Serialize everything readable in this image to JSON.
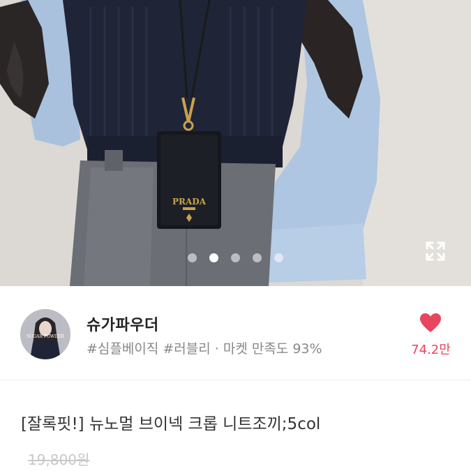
{
  "carousel": {
    "product_logo_text": "PRADA",
    "total_slides": 5,
    "active_slide_index": 2
  },
  "icons": {
    "expand": "expand-icon",
    "heart": "heart-icon"
  },
  "seller": {
    "name": "슈가파우더",
    "tags": "#심플베이직 #러블리 · 마켓 만족도 93%",
    "avatar_text": "SUGAR POWDER",
    "like_count": "74.2만"
  },
  "product": {
    "title": "[잘록핏!] 뉴노멀 브이넥 크롭 니트조끼;5col",
    "original_price": "19,800원"
  },
  "colors": {
    "accent": "#e8455e",
    "muted_text": "#888888"
  }
}
